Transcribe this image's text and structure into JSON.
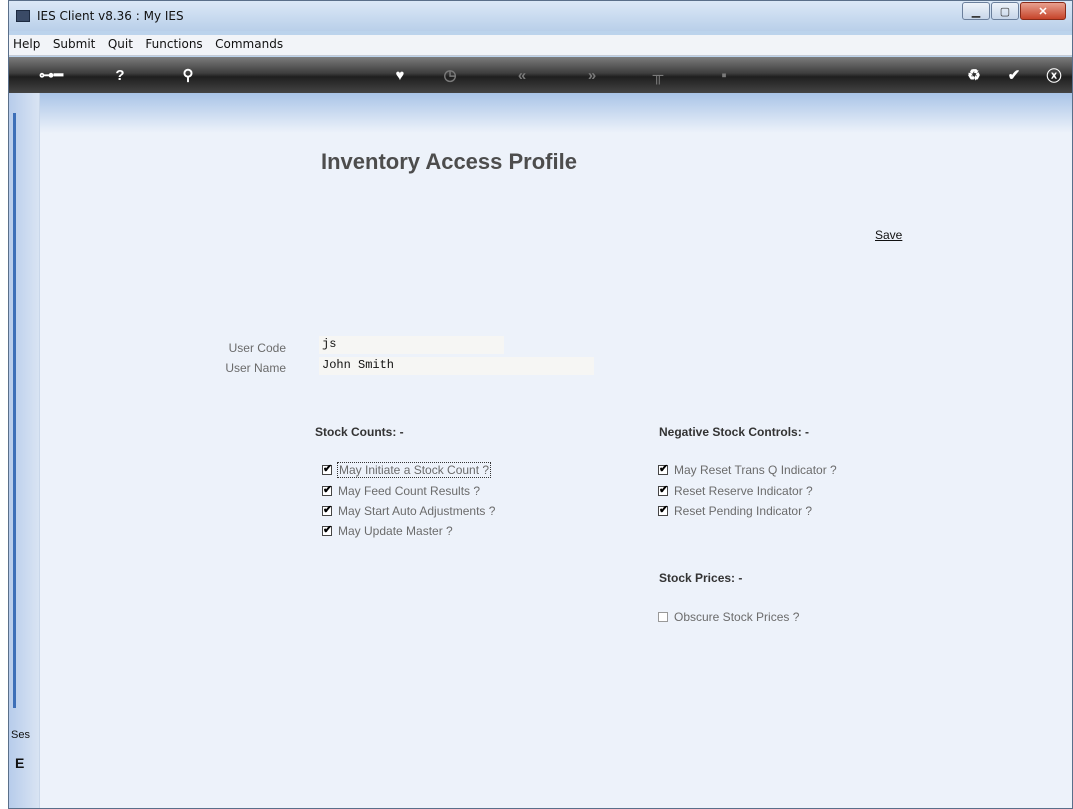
{
  "window": {
    "title": "IES Client v8.36 : My IES"
  },
  "menu": [
    "Help",
    "Submit",
    "Quit",
    "Functions",
    "Commands"
  ],
  "page": {
    "title": "Inventory Access Profile",
    "save_label": "Save"
  },
  "fields": {
    "user_code": {
      "label": "User Code",
      "value": "js"
    },
    "user_name": {
      "label": "User Name",
      "value": "John Smith"
    }
  },
  "stock_counts": {
    "heading": "Stock Counts: -",
    "items": [
      {
        "label": "May Initiate a Stock Count ?",
        "checked": true
      },
      {
        "label": "May Feed Count Results ?",
        "checked": true
      },
      {
        "label": "May Start Auto Adjustments ?",
        "checked": true
      },
      {
        "label": "May Update Master ?",
        "checked": true
      }
    ]
  },
  "negative_stock": {
    "heading": "Negative Stock Controls: -",
    "items": [
      {
        "label": "May Reset Trans Q Indicator ?",
        "checked": true
      },
      {
        "label": "Reset Reserve Indicator ?",
        "checked": true
      },
      {
        "label": "Reset Pending Indicator ?",
        "checked": true
      }
    ]
  },
  "stock_prices": {
    "heading": "Stock Prices: -",
    "items": [
      {
        "label": "Obscure Stock Prices ?",
        "checked": false
      }
    ]
  },
  "sidebar": {
    "session_label": "Ses",
    "session_icon": "E"
  }
}
